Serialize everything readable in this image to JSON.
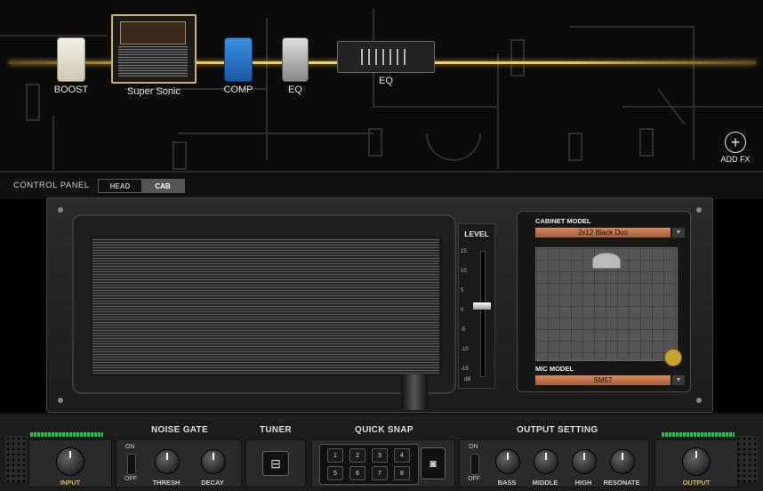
{
  "fx_chain": {
    "items": [
      {
        "label": "BOOST"
      },
      {
        "label": "Super Sonic"
      },
      {
        "label": "COMP"
      },
      {
        "label": "EQ"
      },
      {
        "label": "EQ"
      }
    ],
    "add_fx": "ADD FX"
  },
  "control_panel": {
    "title": "CONTROL PANEL",
    "tabs": [
      "HEAD",
      "CAB"
    ],
    "active_tab": "CAB"
  },
  "cab_panel": {
    "level_title": "LEVEL",
    "level_ticks": [
      "15",
      "10",
      "5",
      "0",
      "-5",
      "-10",
      "-15"
    ],
    "level_unit": "dB",
    "level_value_db": 0,
    "cabinet_model_label": "CABINET MODEL",
    "cabinet_model": "2x12 Black Duo",
    "mic_model_label": "MIC MODEL",
    "mic_model": "SM57"
  },
  "bottom_bar": {
    "input_label": "INPUT",
    "noise_gate": {
      "title": "NOISE GATE",
      "on": "ON",
      "off": "OFF",
      "thresh": "THRESH",
      "decay": "DECAY"
    },
    "tuner": {
      "title": "TUNER"
    },
    "quick_snap": {
      "title": "QUICK SNAP",
      "slots": [
        "1",
        "2",
        "3",
        "4",
        "5",
        "6",
        "7",
        "8"
      ]
    },
    "output_setting": {
      "title": "OUTPUT SETTING",
      "on": "ON",
      "off": "OFF",
      "bass": "BASS",
      "middle": "MIDDLE",
      "high": "HIGH",
      "resonate": "RESONATE"
    },
    "output_label": "OUTPUT"
  },
  "colors": {
    "signal": "#e8c65a",
    "accent_orange": "#d98a5d",
    "meter_green": "#2bbf4a",
    "gold": "#d8b84e"
  }
}
